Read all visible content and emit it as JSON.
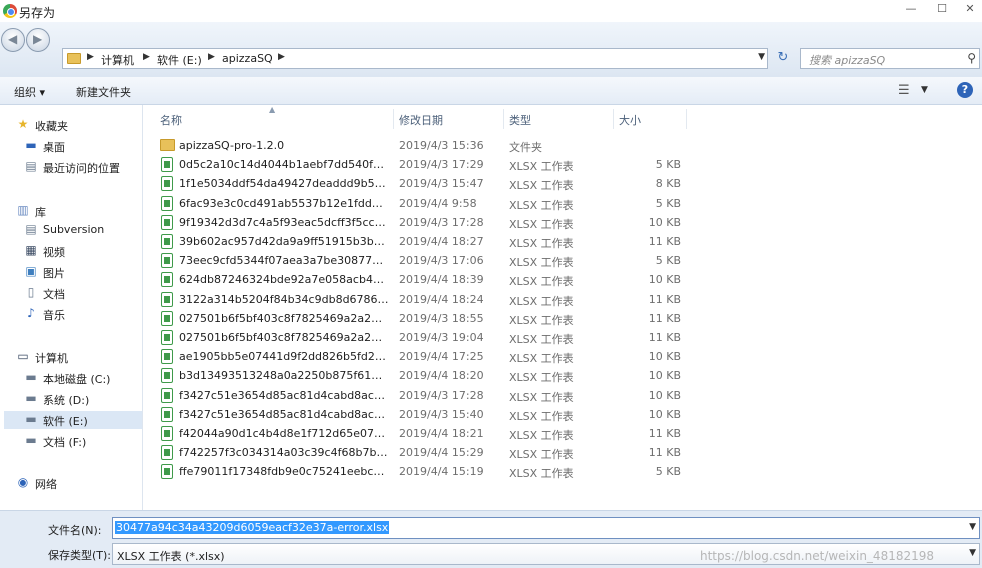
{
  "window": {
    "title": "另存为",
    "min_glyph": "—",
    "max_glyph": "☐",
    "close_glyph": "✕"
  },
  "nav": {
    "breadcrumbs": [
      "计算机",
      "软件 (E:)",
      "apizzaSQ"
    ],
    "separator": "▶",
    "refresh_glyph": "↻",
    "search_placeholder": "搜索 apizzaSQ"
  },
  "toolbar": {
    "organize_label": "组织 ▾",
    "new_folder_label": "新建文件夹",
    "view_glyph": "☰",
    "help_glyph": "?"
  },
  "sidebar": {
    "favorites_label": "收藏夹",
    "favorites": [
      "桌面",
      "最近访问的位置"
    ],
    "libraries_label": "库",
    "libraries": [
      "Subversion",
      "视频",
      "图片",
      "文档",
      "音乐"
    ],
    "computer_label": "计算机",
    "drives": [
      "本地磁盘 (C:)",
      "系统 (D:)",
      "软件 (E:)",
      "文档 (F:)"
    ],
    "selected_drive": "软件 (E:)",
    "network_label": "网络"
  },
  "columns": {
    "name": "名称",
    "date": "修改日期",
    "type": "类型",
    "size": "大小"
  },
  "files": [
    {
      "name": "apizzaSQ-pro-1.2.0",
      "date": "2019/4/3 15:36",
      "type": "文件夹",
      "size": "",
      "icon": "folder-icon"
    },
    {
      "name": "0d5c2a10c14d4044b1aebf7dd540f16...",
      "date": "2019/4/3 17:29",
      "type": "XLSX 工作表",
      "size": "5 KB",
      "icon": "xlsx-file-icon"
    },
    {
      "name": "1f1e5034ddf54da49427deaddd9b5f0...",
      "date": "2019/4/3 15:47",
      "type": "XLSX 工作表",
      "size": "8 KB",
      "icon": "xlsx-file-icon"
    },
    {
      "name": "6fac93e3c0cd491ab5537b12e1fdd30...",
      "date": "2019/4/4 9:58",
      "type": "XLSX 工作表",
      "size": "5 KB",
      "icon": "xlsx-file-icon"
    },
    {
      "name": "9f19342d3d7c4a5f93eac5dcff3f5cc7-t...",
      "date": "2019/4/3 17:28",
      "type": "XLSX 工作表",
      "size": "10 KB",
      "icon": "xlsx-file-icon"
    },
    {
      "name": "39b602ac957d42da9a9ff51915b3b5f...",
      "date": "2019/4/4 18:27",
      "type": "XLSX 工作表",
      "size": "11 KB",
      "icon": "xlsx-file-icon"
    },
    {
      "name": "73eec9cfd5344f07aea3a7be308770b...",
      "date": "2019/4/3 17:06",
      "type": "XLSX 工作表",
      "size": "5 KB",
      "icon": "xlsx-file-icon"
    },
    {
      "name": "624db87246324bde92a7e058acb4db...",
      "date": "2019/4/4 18:39",
      "type": "XLSX 工作表",
      "size": "10 KB",
      "icon": "xlsx-file-icon"
    },
    {
      "name": "3122a314b5204f84b34c9db8d67862...",
      "date": "2019/4/4 18:24",
      "type": "XLSX 工作表",
      "size": "11 KB",
      "icon": "xlsx-file-icon"
    },
    {
      "name": "027501b6f5bf403c8f7825469a2a2658...",
      "date": "2019/4/3 18:55",
      "type": "XLSX 工作表",
      "size": "11 KB",
      "icon": "xlsx-file-icon"
    },
    {
      "name": "027501b6f5bf403c8f7825469a2a2658...",
      "date": "2019/4/3 19:04",
      "type": "XLSX 工作表",
      "size": "11 KB",
      "icon": "xlsx-file-icon"
    },
    {
      "name": "ae1905bb5e07441d9f2dd826b5fd29...",
      "date": "2019/4/4 17:25",
      "type": "XLSX 工作表",
      "size": "10 KB",
      "icon": "xlsx-file-icon"
    },
    {
      "name": "b3d13493513248a0a2250b875f61dc5...",
      "date": "2019/4/4 18:20",
      "type": "XLSX 工作表",
      "size": "10 KB",
      "icon": "xlsx-file-icon"
    },
    {
      "name": "f3427c51e3654d85ac81d4cabd8acb7...",
      "date": "2019/4/3 17:28",
      "type": "XLSX 工作表",
      "size": "10 KB",
      "icon": "xlsx-file-icon"
    },
    {
      "name": "f3427c51e3654d85ac81d4cabd8acb7...",
      "date": "2019/4/3 15:40",
      "type": "XLSX 工作表",
      "size": "10 KB",
      "icon": "xlsx-file-icon"
    },
    {
      "name": "f42044a90d1c4b4d8e1f712d65e071f...",
      "date": "2019/4/4 18:21",
      "type": "XLSX 工作表",
      "size": "11 KB",
      "icon": "xlsx-file-icon"
    },
    {
      "name": "f742257f3c034314a03c39c4f68b7b7e...",
      "date": "2019/4/4 15:29",
      "type": "XLSX 工作表",
      "size": "11 KB",
      "icon": "xlsx-file-icon"
    },
    {
      "name": "ffe79011f17348fdb9e0c75241eebc78...",
      "date": "2019/4/4 15:19",
      "type": "XLSX 工作表",
      "size": "5 KB",
      "icon": "xlsx-file-icon"
    }
  ],
  "bottom": {
    "filename_label": "文件名(N):",
    "filename_value": "30477a94c34a43209d6059eacf32e37a-error.xlsx",
    "savetype_label": "保存类型(T):",
    "savetype_value": "XLSX 工作表 (*.xlsx)",
    "watermark": "https://blog.csdn.net/weixin_48182198"
  }
}
